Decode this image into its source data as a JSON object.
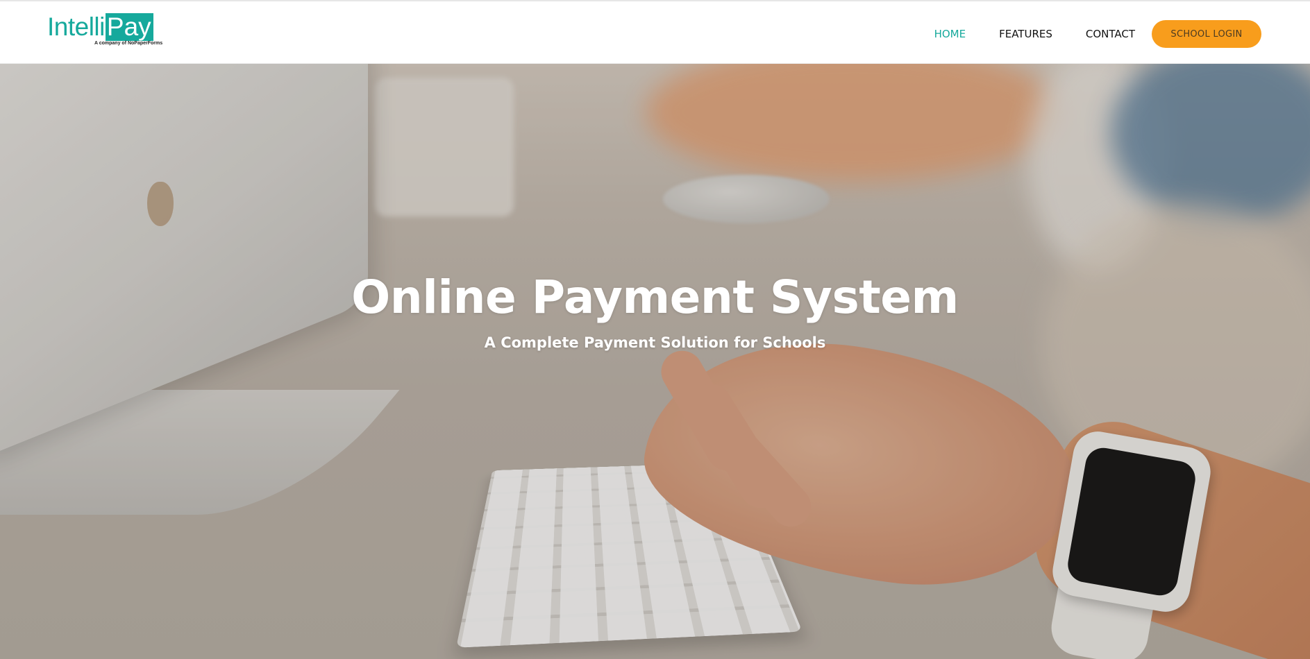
{
  "brand": {
    "logo_part1": "Intelli",
    "logo_part2": "Pay",
    "logo_tagline": "A company of NoPaperForms",
    "accent_color": "#16a99c"
  },
  "nav": {
    "items": [
      {
        "label": "HOME",
        "active": true
      },
      {
        "label": "FEATURES",
        "active": false
      },
      {
        "label": "CONTACT",
        "active": false
      }
    ],
    "login_button": {
      "label": "SCHOOL LOGIN",
      "color": "#f89d1c"
    }
  },
  "hero": {
    "title": "Online Payment System",
    "subtitle": "A Complete Payment Solution for Schools",
    "background": "photo of a hand typing on a keyboard at a desk with a computer, mouse and smartwatch"
  }
}
